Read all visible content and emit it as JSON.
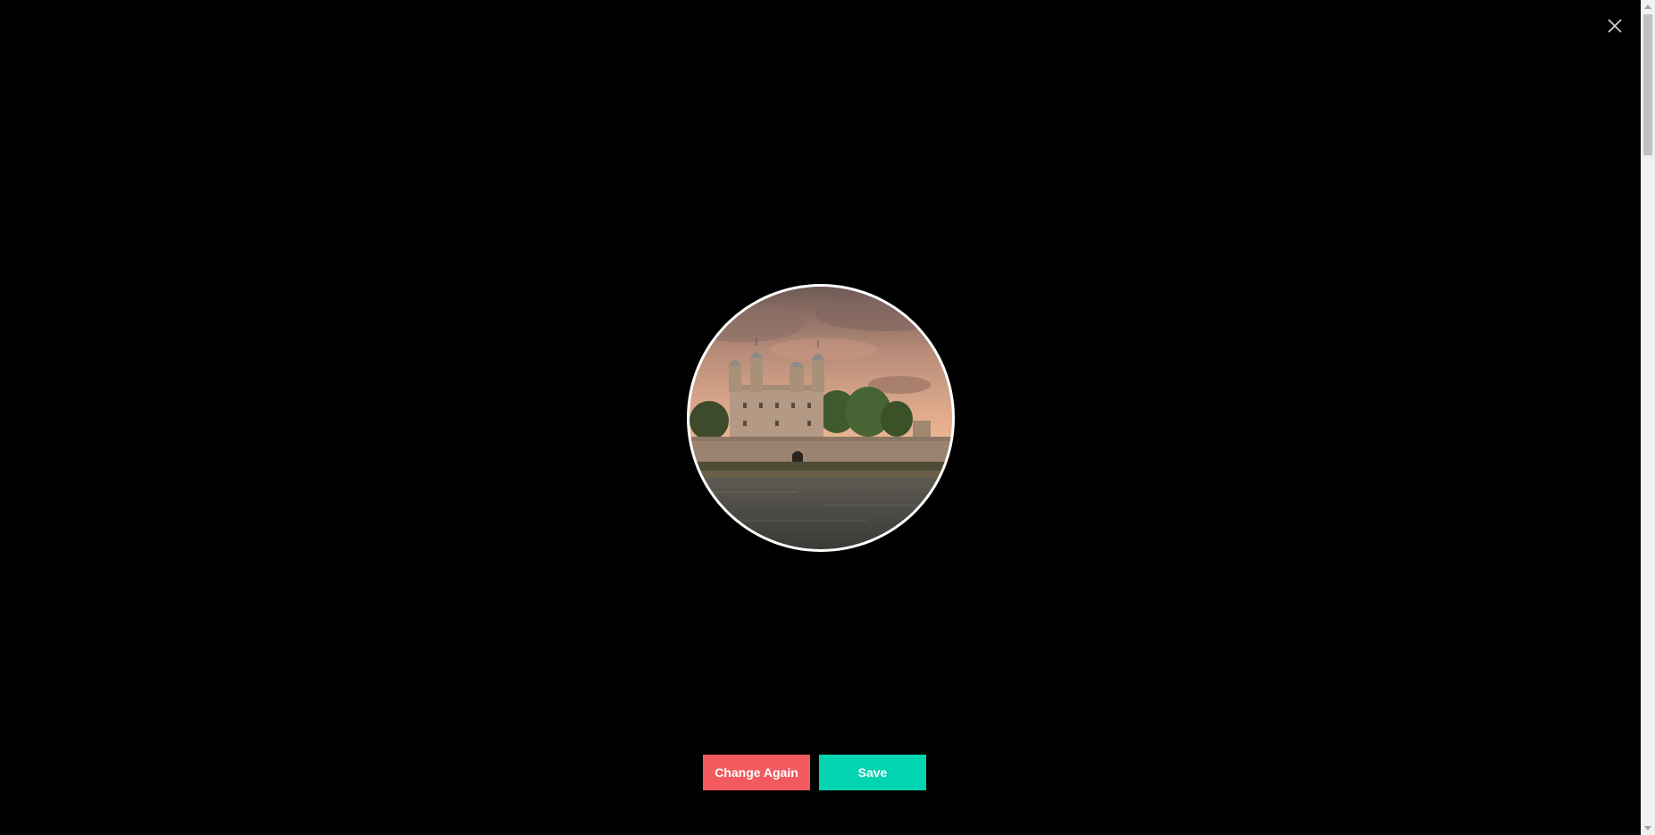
{
  "dialog": {
    "close_icon": "close-icon",
    "preview_image": "profile-photo-tower-of-london"
  },
  "actions": {
    "change_again_label": "Change Again",
    "save_label": "Save"
  },
  "colors": {
    "background": "#000000",
    "change_again": "#f25a5f",
    "save": "#00d4b0"
  }
}
